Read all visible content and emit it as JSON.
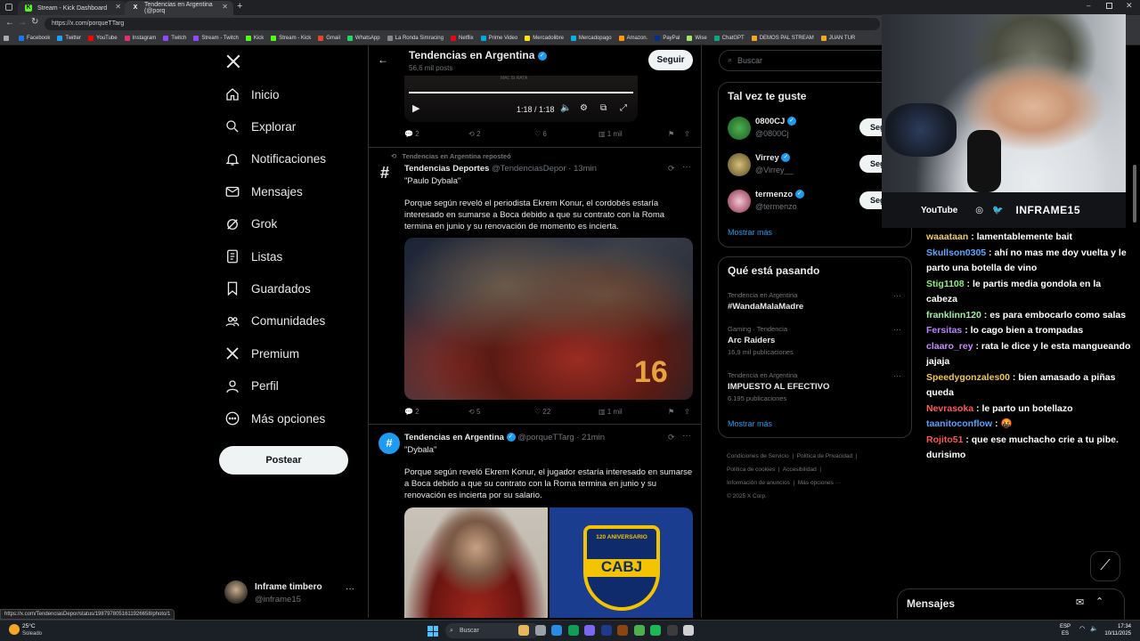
{
  "browser": {
    "tabs": [
      {
        "title": "Stream - Kick Dashboard",
        "favicon": "K"
      },
      {
        "title": "Tendencias en Argentina (@porq",
        "favicon": "X"
      }
    ],
    "url": "https://x.com/porqueTTarg",
    "status_url": "https://x.com/TendenciasDepor/status/1987978051611926658/photo/1",
    "bookmarks": [
      "Facebook",
      "Twitter",
      "YouTube",
      "Instagram",
      "Twitch",
      "Stream - Twitch",
      "Kick",
      "Stream - Kick",
      "Gmail",
      "WhatsApp",
      "La Ronda Simracing",
      "Netflix",
      "Prime Video",
      "Mercadolibre",
      "Mercadopago",
      "Amazon.",
      "PayPal",
      "Wise",
      "ChatGPT",
      "DEMOS PAL STREAM",
      "JUAN TUR"
    ]
  },
  "sidebar": {
    "items": [
      {
        "label": "Inicio",
        "icon": "home-icon"
      },
      {
        "label": "Explorar",
        "icon": "search-icon"
      },
      {
        "label": "Notificaciones",
        "icon": "bell-icon"
      },
      {
        "label": "Mensajes",
        "icon": "mail-icon"
      },
      {
        "label": "Grok",
        "icon": "grok-icon"
      },
      {
        "label": "Listas",
        "icon": "list-icon"
      },
      {
        "label": "Guardados",
        "icon": "bookmark-icon"
      },
      {
        "label": "Comunidades",
        "icon": "people-icon"
      },
      {
        "label": "Premium",
        "icon": "x-logo-icon"
      },
      {
        "label": "Perfil",
        "icon": "person-icon"
      },
      {
        "label": "Más opciones",
        "icon": "more-circle-icon"
      }
    ],
    "post_button": "Postear",
    "account": {
      "name": "Inframe timbero",
      "handle": "@inframe15"
    }
  },
  "profile_header": {
    "title": "Tendencias en Argentina",
    "posts": "56,6 mil posts",
    "follow": "Seguir"
  },
  "video": {
    "time": "1:18 / 1:18",
    "caption": "MAL SI RATA"
  },
  "tweet0_actions": {
    "replies": "2",
    "reposts": "2",
    "likes": "6",
    "views": "1 mil"
  },
  "tweet1": {
    "repost_note": "Tendencias en Argentina reposteó",
    "name": "Tendencias Deportes",
    "handle": "@TendenciasDepor",
    "time": "· 13min",
    "title": "\"Paulo Dybala\"",
    "body": "Porque según reveló el periodista Ekrem Konur, el cordobés estaría interesado en sumarse a Boca debido a que su contrato con la Roma termina en junio y su renovación de momento es incierta.",
    "replies": "2",
    "reposts": "5",
    "likes": "22",
    "views": "1 mil"
  },
  "tweet2": {
    "name": "Tendencias en Argentina",
    "handle": "@porqueTTarg",
    "time": "· 21min",
    "title": "\"Dybala\"",
    "body": "Porque según reveló Ekrem Konur, el jugador estaría interesado en sumarse a Boca debido a que su contrato con la Roma termina en junio y su renovación es incierta por su salario.",
    "crest_top": "120 ANIVERSARIO",
    "crest_text": "CABJ"
  },
  "search": {
    "placeholder": "Buscar"
  },
  "suggestions": {
    "title": "Tal vez te guste",
    "users": [
      {
        "name": "0800CJ",
        "handle": "@0800Cj",
        "button": "Seguir"
      },
      {
        "name": "Virrey",
        "handle": "@Virrey__",
        "button": "Seguir"
      },
      {
        "name": "termenzo",
        "handle": "@termenzo",
        "button": "Seguir"
      }
    ],
    "more": "Mostrar más"
  },
  "trends": {
    "title": "Qué está pasando",
    "items": [
      {
        "context": "Tendencia en Argentina",
        "name": "#WandaMalaMadre",
        "count": ""
      },
      {
        "context": "Gaming · Tendencia",
        "name": "Arc Raiders",
        "count": "16,9 mil publicaciones"
      },
      {
        "context": "Tendencia en Argentina",
        "name": "IMPUESTO AL EFECTIVO",
        "count": "6.195 publicaciones"
      }
    ],
    "more": "Mostrar más"
  },
  "footer_links": [
    "Condiciones de Servicio",
    "Política de Privacidad",
    "Política de cookies",
    "Accesibilidad",
    "Información de anuncios",
    "Más opciones ···",
    "© 2025 X Corp."
  ],
  "webcam": {
    "youtube": "YouTube",
    "brand": "INFRAME15"
  },
  "chat": {
    "messages": [
      {
        "user": "waaataan",
        "color": "#f0c96b",
        "text": "lamentablemente bait"
      },
      {
        "user": "Skullson0305",
        "color": "#59a8ff",
        "text": "ahí no mas me doy vuelta y le parto una botella de vino"
      },
      {
        "user": "Stig1108",
        "color": "#8ef07a",
        "text": "le partis media gondola en la cabeza"
      },
      {
        "user": "franklinn120",
        "color": "#9ef0a8",
        "text": "es para embocarlo como salas"
      },
      {
        "user": "Fersitas",
        "color": "#b783ff",
        "text": "lo cago bien a trompadas"
      },
      {
        "user": "claaro_rey",
        "color": "#c98cff",
        "text": "rata le dice y le esta mangueando jajaja"
      },
      {
        "user": "Speedygonzales00",
        "color": "#f4c84a",
        "text": "bien amasado a piñas queda"
      },
      {
        "user": "Nevrasoka",
        "color": "#ff5a5a",
        "text": "le parto un botellazo"
      },
      {
        "user": "taanitoconflow",
        "color": "#5aa0ff",
        "text": "🤬"
      },
      {
        "user": "Rojito51",
        "color": "#ff5555",
        "text": "que ese muchacho crie a tu pibe. durisimo"
      }
    ]
  },
  "messages_bar": {
    "label": "Mensajes"
  },
  "taskbar": {
    "weather_temp": "25°C",
    "weather_desc": "Soleado",
    "search": "Buscar",
    "lang1": "ESP",
    "lang2": "ES",
    "time": "17:34",
    "date": "10/11/2025"
  },
  "colors": {
    "accent": "#1d9bf0",
    "bg": "#000000",
    "border": "#2f3336",
    "muted": "#71767b"
  }
}
